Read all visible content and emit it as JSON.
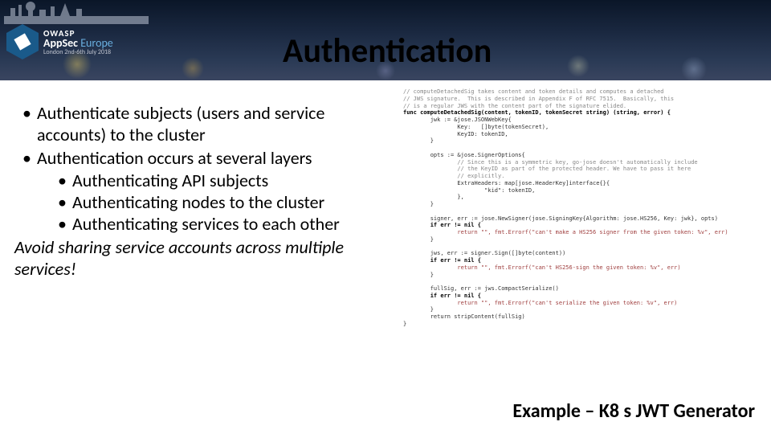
{
  "brand": {
    "owasp": "OWASP",
    "appsec": "AppSec",
    "europe": "Europe",
    "sub": "London 2nd-6th July 2018"
  },
  "title": "Authentication",
  "bullets": {
    "b1": "Authenticate subjects (users and service accounts) to the cluster",
    "b2": "Authentication occurs at several layers",
    "s1": "Authenticating API subjects",
    "s2": "Authenticating nodes to the cluster",
    "s3": "Authenticating services to each other"
  },
  "note": "Avoid sharing service accounts across multiple services!",
  "caption": "Example – K8 s JWT Generator",
  "code": {
    "l1": "// computeDetachedSig takes content and token details and computes a detached",
    "l2": "// JWS signature.  This is described in Appendix F of RFC 7515.  Basically, this",
    "l3": "// is a regular JWS with the content part of the signature elided.",
    "l4": "func computeDetachedSig(content, tokenID, tokenSecret string) (string, error) {",
    "l5": "        jwk := &jose.JSONWebKey{",
    "l6": "                Key:   []byte(tokenSecret),",
    "l7": "                KeyID: tokenID,",
    "l8": "        }",
    "l9": "",
    "l10": "        opts := &jose.SignerOptions{",
    "l11": "                // Since this is a symmetric key, go-jose doesn't automatically include",
    "l12": "                // the KeyID as part of the protected header. We have to pass it here",
    "l13": "                // explicitly.",
    "l14": "                ExtraHeaders: map[jose.HeaderKey]interface{}{",
    "l15": "                        \"kid\": tokenID,",
    "l16": "                },",
    "l17": "        }",
    "l18": "",
    "l19": "        signer, err := jose.NewSigner(jose.SigningKey{Algorithm: jose.HS256, Key: jwk}, opts)",
    "l20": "        if err != nil {",
    "l21": "                return \"\", fmt.Errorf(\"can't make a HS256 signer from the given token: %v\", err)",
    "l22": "        }",
    "l23": "",
    "l24": "        jws, err := signer.Sign([]byte(content))",
    "l25": "        if err != nil {",
    "l26": "                return \"\", fmt.Errorf(\"can't HS256-sign the given token: %v\", err)",
    "l27": "        }",
    "l28": "",
    "l29": "        fullSig, err := jws.CompactSerialize()",
    "l30": "        if err != nil {",
    "l31": "                return \"\", fmt.Errorf(\"can't serialize the given token: %v\", err)",
    "l32": "        }",
    "l33": "        return stripContent(fullSig)",
    "l34": "}"
  }
}
